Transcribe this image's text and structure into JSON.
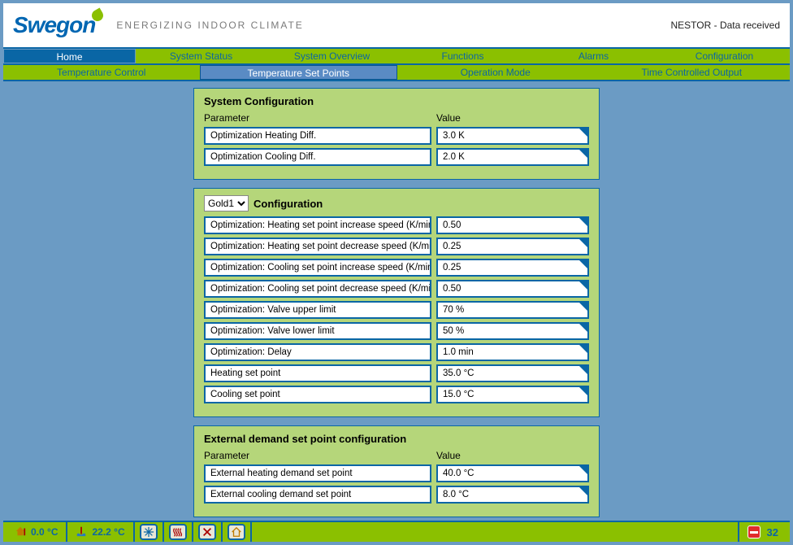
{
  "header": {
    "logo": "Swegon",
    "tagline": "ENERGIZING INDOOR CLIMATE",
    "status": "NESTOR - Data received"
  },
  "main_nav": {
    "items": [
      "Home",
      "System Status",
      "System Overview",
      "Functions",
      "Alarms",
      "Configuration"
    ],
    "active_index": 0
  },
  "sub_nav": {
    "items": [
      "Temperature Control",
      "Temperature Set Points",
      "Operation Mode",
      "Time Controlled Output"
    ],
    "active_index": 1
  },
  "panels": {
    "system_config": {
      "title": "System Configuration",
      "col1": "Parameter",
      "col2": "Value",
      "rows": [
        {
          "param": "Optimization Heating Diff.",
          "value": "3.0 K"
        },
        {
          "param": "Optimization Cooling Diff.",
          "value": "2.0 K"
        }
      ]
    },
    "unit_config": {
      "selector_options": [
        "Gold1"
      ],
      "selector_value": "Gold1",
      "title": "Configuration",
      "rows": [
        {
          "param": "Optimization: Heating set point increase speed (K/min)",
          "value": "0.50"
        },
        {
          "param": "Optimization: Heating set point decrease speed (K/min)",
          "value": "0.25"
        },
        {
          "param": "Optimization: Cooling set point increase speed (K/min)",
          "value": "0.25"
        },
        {
          "param": "Optimization: Cooling set point decrease speed (K/min)",
          "value": "0.50"
        },
        {
          "param": "Optimization: Valve upper limit",
          "value": "70 %"
        },
        {
          "param": "Optimization: Valve lower limit",
          "value": "50 %"
        },
        {
          "param": "Optimization: Delay",
          "value": "1.0 min"
        },
        {
          "param": "Heating set point",
          "value": "35.0 °C"
        },
        {
          "param": "Cooling set point",
          "value": "15.0 °C"
        }
      ]
    },
    "external": {
      "title": "External demand set point configuration",
      "col1": "Parameter",
      "col2": "Value",
      "rows": [
        {
          "param": "External heating demand set point",
          "value": "40.0 °C"
        },
        {
          "param": "External cooling demand set point",
          "value": "8.0 °C"
        }
      ]
    }
  },
  "footer": {
    "temp1": "0.0 °C",
    "temp2": "22.2 °C",
    "alarm_count": "32"
  }
}
